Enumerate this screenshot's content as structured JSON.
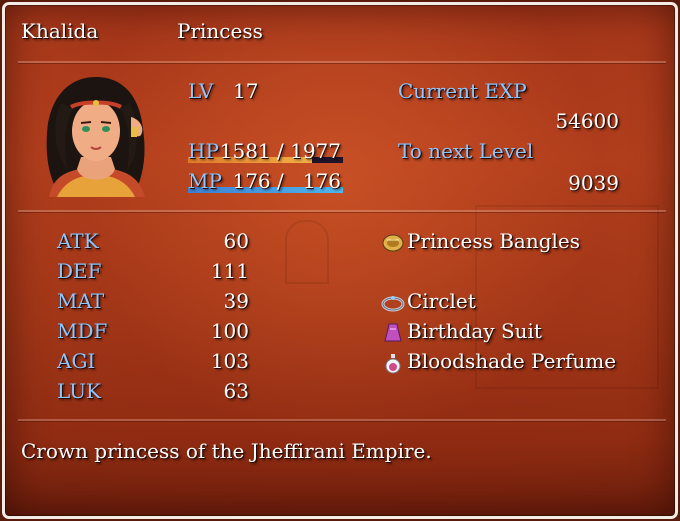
{
  "actor": {
    "name": "Khalida",
    "class": "Princess"
  },
  "status": {
    "lv_label": "LV",
    "lv_value": "17",
    "hp_label": "HP",
    "hp_text": "1581 / 1977",
    "hp_fraction": 0.8,
    "mp_label": "MP",
    "mp_text": "176 /   176",
    "mp_fraction": 1.0,
    "exp_label": "Current EXP",
    "exp_value": "54600",
    "next_label": "To next Level",
    "next_value": "9039"
  },
  "params": [
    {
      "label": "ATK",
      "value": "60"
    },
    {
      "label": "DEF",
      "value": "111"
    },
    {
      "label": "MAT",
      "value": "39"
    },
    {
      "label": "MDF",
      "value": "100"
    },
    {
      "label": "AGI",
      "value": "103"
    },
    {
      "label": "LUK",
      "value": "63"
    }
  ],
  "equipment": [
    {
      "name": "Princess Bangles",
      "icon": "bangles-icon"
    },
    {
      "name": "",
      "icon": ""
    },
    {
      "name": "Circlet",
      "icon": "circlet-icon"
    },
    {
      "name": "Birthday Suit",
      "icon": "birthday-suit-icon"
    },
    {
      "name": "Bloodshade Perfume",
      "icon": "perfume-icon"
    }
  ],
  "profile": "Crown princess of the Jheffirani Empire.",
  "colors": {
    "system_text": "#8cc6ff",
    "hp_gauge_start": "#e07a2a",
    "hp_gauge_end": "#f2b046",
    "mp_gauge_start": "#3f7fd0",
    "mp_gauge_end": "#4fb6ee"
  }
}
